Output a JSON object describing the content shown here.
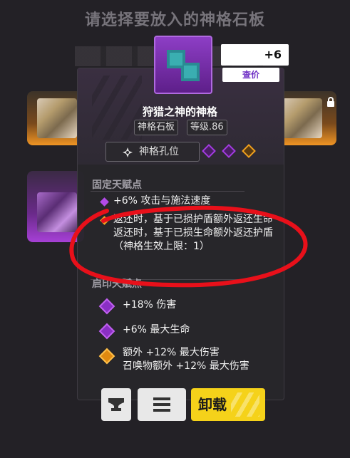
{
  "page_title": "请选择要放入的神格石板",
  "background": {
    "rest_label": "+6"
  },
  "panel": {
    "price_label": "查价",
    "item_name": "狩猎之神的神格",
    "tags": [
      "神格石板",
      "等级.86"
    ],
    "socket_label": "神格孔位",
    "socket_colors": [
      "#a23be0",
      "#a23be0",
      "#f0a01e"
    ],
    "fixed_section_title": "固定天赋点",
    "fixed_attrs": [
      {
        "text": "+6% 攻击与施法速度",
        "color": "#b24ae8"
      },
      {
        "text": "返还时，基于已损护盾额外返还生命\n返还时，基于已损生命额外返还护盾（神格生效上限：1）",
        "color": "#f0a01e"
      }
    ],
    "random_section_title": "启印天赋点",
    "random_attrs": [
      {
        "text": "+18% 伤害",
        "color": "#a23be0"
      },
      {
        "text": "+6% 最大生命",
        "color": "#a23be0"
      },
      {
        "text": "额外 +12% 最大伤害\n召唤物额外 +12% 最大伤害",
        "color": "#f0a01e"
      }
    ]
  },
  "buttons": {
    "unload_label": "卸载"
  },
  "colors": {
    "accent_purple": "#a23be0",
    "accent_orange": "#f0a01e",
    "unload_yellow": "#f5d21a",
    "annotation_red": "#e8101a"
  }
}
